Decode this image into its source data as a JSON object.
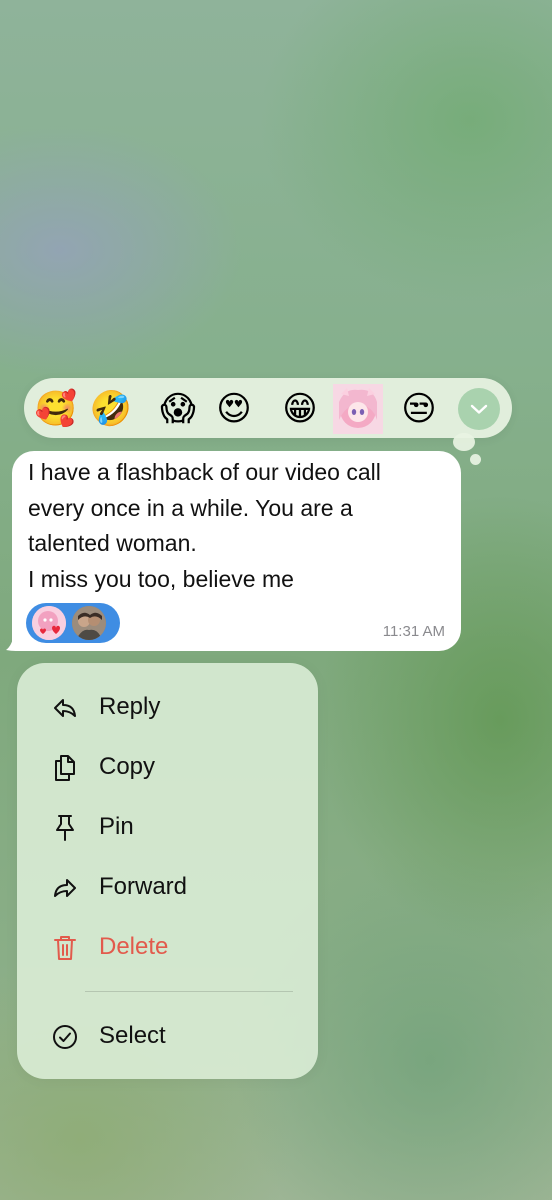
{
  "reaction_bar": {
    "emojis": [
      {
        "icon": "smiling-face-with-hearts-icon"
      },
      {
        "icon": "rolling-on-floor-laughing-icon"
      },
      {
        "icon": "face-screaming-in-fear-icon"
      },
      {
        "icon": "heart-eyes-icon"
      },
      {
        "icon": "beaming-face-icon"
      },
      {
        "icon": "anime-sticker-icon"
      },
      {
        "icon": "unamused-face-icon"
      }
    ],
    "expand_icon": "chevron-down-icon"
  },
  "message": {
    "text": "I have a flashback of our video call\nevery once in a while. You are a\ntalented woman.\nI miss you too, believe me",
    "time": "11:31 AM",
    "reactions_color": "#3f8de3"
  },
  "context_menu": {
    "items": [
      {
        "label": "Reply",
        "icon": "reply-icon"
      },
      {
        "label": "Copy",
        "icon": "copy-icon"
      },
      {
        "label": "Pin",
        "icon": "pin-icon"
      },
      {
        "label": "Forward",
        "icon": "forward-icon"
      },
      {
        "label": "Delete",
        "icon": "trash-icon",
        "color": "#e25a4c"
      },
      {
        "label": "Select",
        "icon": "checkmark-circle-icon"
      }
    ]
  }
}
